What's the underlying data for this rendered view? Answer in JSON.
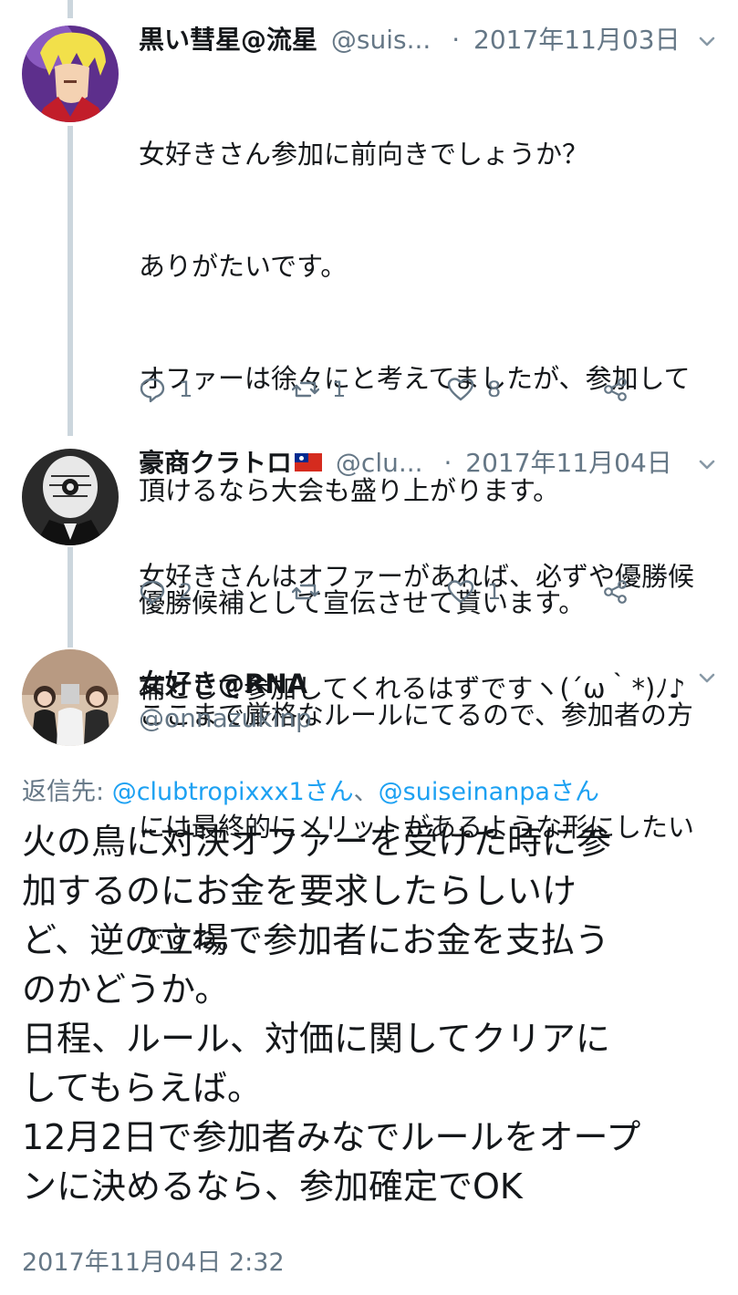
{
  "tweets": [
    {
      "name": "黒い彗星@流星",
      "handle": "@suis...",
      "separator": "·",
      "date": "2017年11月03日",
      "lines": [
        "女好きさん参加に前向きでしょうか？",
        "ありがたいです。",
        "オファーは徐々にと考えてましたが、参加して",
        "頂けるなら大会も盛り上がります。",
        "優勝候補として宣伝させて貰います。",
        "ここまで厳格なルールにてるので、参加者の方",
        "には最終的にメリットがあるような形にしたい",
        "ですね。"
      ],
      "replies": "1",
      "retweets": "1",
      "likes": "8"
    },
    {
      "name": "豪商クラトロ",
      "handle": "@clu...",
      "separator": "·",
      "date": "2017年11月04日",
      "lines": [
        "女好きさんはオファーがあれば、必ずや優勝候",
        "補として参加してくれるはずですヽ(´ω｀*)ﾉ♪"
      ],
      "replies": "2",
      "retweets": "",
      "likes": "1"
    }
  ],
  "main": {
    "name": "女好き@RNA",
    "handle": "@onnazukinp",
    "reply_prefix": "返信先: ",
    "mention1": "@clubtropixxx1さん",
    "reply_sep": "、",
    "mention2": "@suiseinanpaさん",
    "lines": [
      "火の鳥に対決オファーを受けた時に参",
      "加するのにお金を要求したらしいけ",
      "ど、逆の立場で参加者にお金を支払う",
      "のかどうか。",
      "日程、ルール、対価に関してクリアに",
      "してもらえば。",
      "12月2日で参加者みなでルールをオープ",
      "ンに決めるなら、参加確定でOK"
    ],
    "timestamp": "2017年11月04日 2:32"
  },
  "icons": {
    "reply": "reply-icon",
    "retweet": "retweet-icon",
    "like": "heart-icon",
    "share": "share-icon",
    "more": "chevron-down-icon",
    "flag": "taiwan-flag-icon"
  },
  "colors": {
    "text": "#14171a",
    "secondary": "#657786",
    "link": "#1da1f2",
    "thread_line": "#ccd6dd"
  }
}
